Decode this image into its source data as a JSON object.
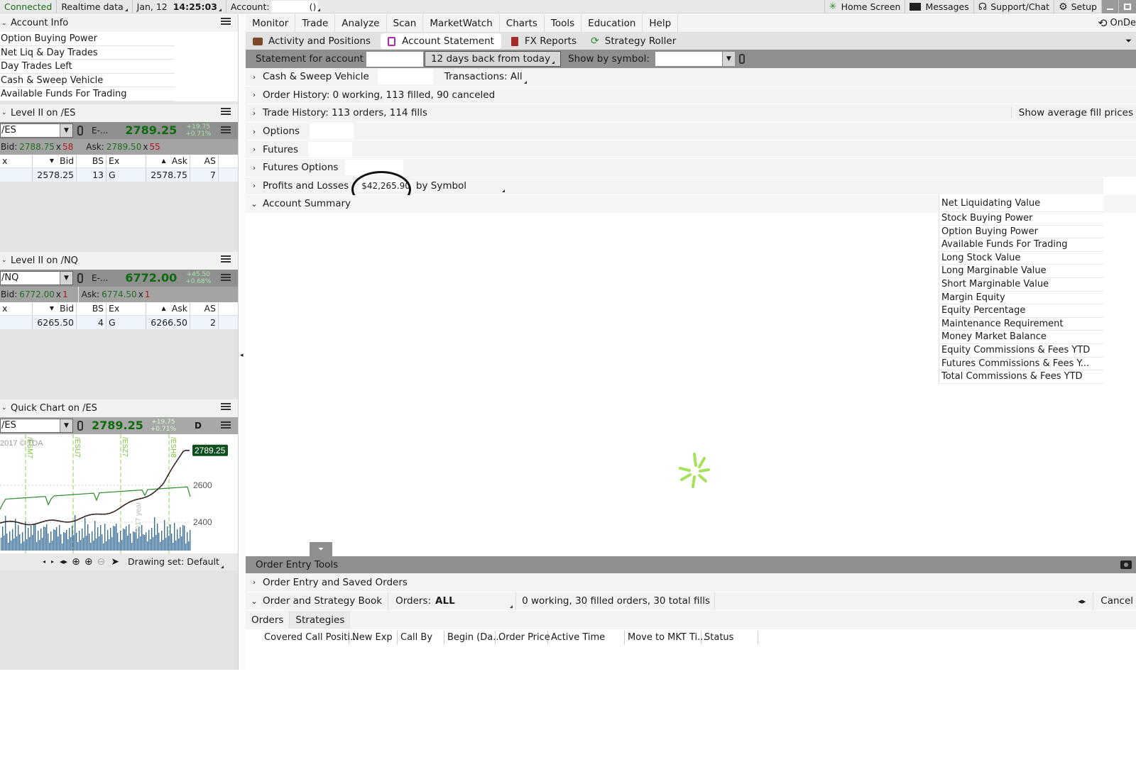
{
  "status_bar": {
    "connection": "Connected",
    "data_feed": "Realtime data",
    "date": "Jan, 12",
    "time": "14:25:03",
    "account_label": "Account:",
    "account_suffix": "()",
    "home": "Home Screen",
    "messages": "Messages",
    "support": "Support/Chat",
    "setup": "Setup"
  },
  "account_info": {
    "title": "Account Info",
    "items": [
      "Option Buying Power",
      "Net Liq & Day Trades",
      "Day Trades Left",
      "Cash & Sweep Vehicle",
      "Available Funds For Trading"
    ]
  },
  "level2_es": {
    "title": "Level II on /ES",
    "symbol": "/ES",
    "desc": "E-...",
    "last": "2789.25",
    "change": "+19.75",
    "change_pct": "+0.71%",
    "bid_label": "Bid:",
    "bid": "2788.75",
    "bid_size": "58",
    "ask_label": "Ask:",
    "ask": "2789.50",
    "ask_size": "55",
    "headers": [
      "x",
      "Bid",
      "BS",
      "Ex",
      "Ask",
      "AS"
    ],
    "row": [
      "",
      "2578.25",
      "13",
      "G",
      "2578.75",
      "7"
    ]
  },
  "level2_nq": {
    "title": "Level II on /NQ",
    "symbol": "/NQ",
    "desc": "E-...",
    "last": "6772.00",
    "change": "+45.50",
    "change_pct": "+0.68%",
    "bid_label": "Bid:",
    "bid": "6772.00",
    "bid_size": "1",
    "ask_label": "Ask:",
    "ask": "6774.50",
    "ask_size": "1",
    "headers": [
      "x",
      "Bid",
      "BS",
      "Ex",
      "Ask",
      "AS"
    ],
    "row": [
      "",
      "6265.50",
      "4",
      "G",
      "6266.50",
      "2"
    ]
  },
  "quick_chart": {
    "title": "Quick Chart on /ES",
    "symbol": "/ES",
    "last": "2789.25",
    "change": "+19.75",
    "change_pct": "+0.71%",
    "period": "D",
    "copyright": "2017 © TDA",
    "price_tag": "2789.25",
    "y_labels": [
      "2600",
      "2400"
    ],
    "contracts": [
      "/ESM7",
      "/ESU7",
      "/ESZ7",
      "/ESH8"
    ],
    "year_label": "2017 year",
    "drawing_set": "Drawing set: Default"
  },
  "menu": {
    "items": [
      "Monitor",
      "Trade",
      "Analyze",
      "Scan",
      "MarketWatch",
      "Charts",
      "Tools",
      "Education",
      "Help"
    ],
    "right": "OnDe"
  },
  "tabs": {
    "items": [
      "Activity and Positions",
      "Account Statement",
      "FX Reports",
      "Strategy Roller"
    ]
  },
  "statement": {
    "for_account": "Statement for account",
    "range": "12 days back from today",
    "show_by_symbol": "Show by symbol:"
  },
  "sections": {
    "cash": "Cash & Sweep Vehicle",
    "transactions": "Transactions: All",
    "order_history": "Order History: 0 working, 113 filled, 90 canceled",
    "trade_history": "Trade History: 113 orders, 114 fills",
    "show_avg": "Show average fill prices",
    "options": "Options",
    "futures": "Futures",
    "futures_options": "Futures Options",
    "pnl": "Profits and Losses",
    "pnl_value": "$42,265.90",
    "by_symbol": "by Symbol",
    "account_summary": "Account Summary"
  },
  "summary_items": [
    "Net Liquidating Value",
    "Stock Buying Power",
    "Option Buying Power",
    "Available Funds For Trading",
    "Long Stock Value",
    "Long Marginable Value",
    "Short Marginable Value",
    "Margin Equity",
    "Equity Percentage",
    "Maintenance Requirement",
    "Money Market Balance",
    "Equity Commissions & Fees YTD",
    "Futures Commissions & Fees Y...",
    "Total Commissions & Fees YTD"
  ],
  "order_entry": {
    "title": "Order Entry Tools",
    "saved_orders": "Order Entry and Saved Orders",
    "book": "Order and Strategy Book",
    "orders_label": "Orders:",
    "orders_value": "ALL",
    "summary": "0 working, 30 filled orders, 30 total fills",
    "cancel": "Cancel",
    "tab_orders": "Orders",
    "tab_strategies": "Strategies",
    "columns": [
      "Covered Call Positi...",
      "New Exp",
      "Call By",
      "Begin (Da...",
      "Order Price",
      "Active Time",
      "Move to MKT Ti...",
      "Status"
    ]
  },
  "colors": {
    "price_green": "#0d6b0d",
    "bid_green": "#1f6e1f",
    "size_red": "#b01818",
    "chart_green": "#2a8c2a",
    "chart_volume": "#3a6f9a",
    "loading_green": "#a6e35a"
  }
}
